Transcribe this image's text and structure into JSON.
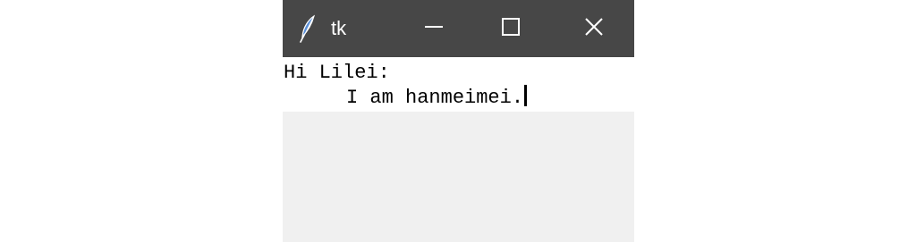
{
  "window": {
    "title": "tk",
    "app_icon": "feather-icon",
    "controls": {
      "minimize": "minimize-icon",
      "maximize": "maximize-icon",
      "close": "close-icon"
    },
    "titlebar_color": "#474747"
  },
  "text_widget": {
    "lines": [
      "Hi Lilei:",
      "I am hanmeimei."
    ],
    "background": "#ffffff"
  },
  "frame_background": "#f0f0f0"
}
